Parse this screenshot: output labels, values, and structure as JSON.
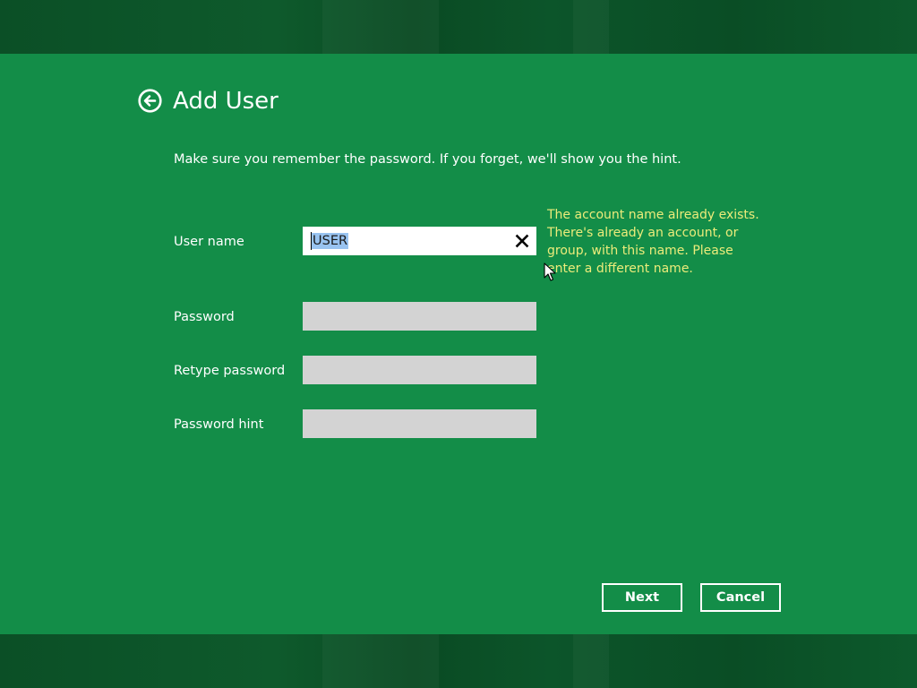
{
  "colors": {
    "dialog_background": "#138d48",
    "backdrop": "#0b4f26",
    "text": "#ffffff",
    "error_text": "#ecec7a",
    "input_disabled": "#d3d3d3",
    "selection": "#99c3f0"
  },
  "header": {
    "back_icon": "back-arrow-circle-icon",
    "title": "Add User"
  },
  "instruction": "Make sure you remember the password. If you forget, we'll show you the hint.",
  "form": {
    "username": {
      "label": "User name",
      "value": "USER",
      "clear_icon": "close-icon"
    },
    "password": {
      "label": "Password",
      "value": ""
    },
    "retype_password": {
      "label": "Retype password",
      "value": ""
    },
    "password_hint": {
      "label": "Password hint",
      "value": ""
    }
  },
  "error": {
    "lines": [
      "The account name already exists.",
      "There's already an account, or",
      "group, with this name.  Please",
      "enter a different name."
    ]
  },
  "buttons": {
    "next": "Next",
    "cancel": "Cancel"
  }
}
